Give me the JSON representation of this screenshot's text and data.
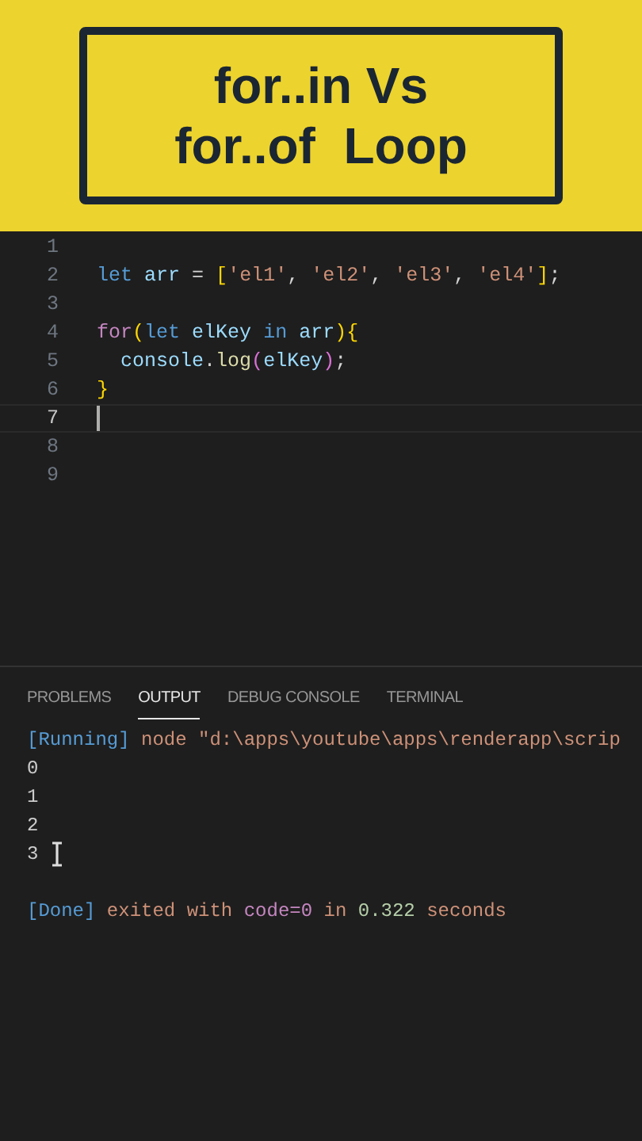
{
  "banner": {
    "title_lines": [
      "for..in Vs",
      "for..of  Loop"
    ]
  },
  "editor": {
    "lines": [
      {
        "number": "1",
        "current": false
      },
      {
        "number": "2",
        "current": false,
        "tokens": [
          {
            "text": "let ",
            "kind": "keyword"
          },
          {
            "text": "arr",
            "kind": "variable"
          },
          {
            "text": " = ",
            "kind": "punct"
          },
          {
            "text": "[",
            "kind": "bracket"
          },
          {
            "text": "'el1'",
            "kind": "string"
          },
          {
            "text": ", ",
            "kind": "punct"
          },
          {
            "text": "'el2'",
            "kind": "string"
          },
          {
            "text": ", ",
            "kind": "punct"
          },
          {
            "text": "'el3'",
            "kind": "string"
          },
          {
            "text": ", ",
            "kind": "punct"
          },
          {
            "text": "'el4'",
            "kind": "string"
          },
          {
            "text": "]",
            "kind": "bracket"
          },
          {
            "text": ";",
            "kind": "punct"
          }
        ]
      },
      {
        "number": "3",
        "current": false
      },
      {
        "number": "4",
        "current": false,
        "tokens": [
          {
            "text": "for",
            "kind": "control"
          },
          {
            "text": "(",
            "kind": "bracket"
          },
          {
            "text": "let ",
            "kind": "keyword"
          },
          {
            "text": "elKey",
            "kind": "variable"
          },
          {
            "text": " in ",
            "kind": "keyword"
          },
          {
            "text": "arr",
            "kind": "variable"
          },
          {
            "text": "){",
            "kind": "bracket"
          }
        ]
      },
      {
        "number": "5",
        "current": false,
        "tokens": [
          {
            "text": "  console",
            "kind": "variable"
          },
          {
            "text": ".",
            "kind": "punct"
          },
          {
            "text": "log",
            "kind": "func"
          },
          {
            "text": "(",
            "kind": "bracket2"
          },
          {
            "text": "elKey",
            "kind": "variable"
          },
          {
            "text": ")",
            "kind": "bracket2"
          },
          {
            "text": ";",
            "kind": "punct"
          }
        ]
      },
      {
        "number": "6",
        "current": false,
        "tokens": [
          {
            "text": "}",
            "kind": "bracket"
          }
        ]
      },
      {
        "number": "7",
        "current": true
      },
      {
        "number": "8",
        "current": false
      },
      {
        "number": "9",
        "current": false
      }
    ]
  },
  "panel": {
    "tabs": [
      {
        "label": "PROBLEMS",
        "selected": false
      },
      {
        "label": "OUTPUT",
        "selected": true
      },
      {
        "label": "DEBUG CONSOLE",
        "selected": false
      },
      {
        "label": "TERMINAL",
        "selected": false
      }
    ],
    "output": [
      {
        "tokens": [
          {
            "text": "[Running]",
            "kind": "info"
          },
          {
            "text": " node \"d:\\apps\\youtube\\apps\\renderapp\\scrip",
            "kind": "string"
          }
        ]
      },
      {
        "tokens": [
          {
            "text": "0",
            "kind": "plain"
          }
        ]
      },
      {
        "tokens": [
          {
            "text": "1",
            "kind": "plain"
          }
        ]
      },
      {
        "tokens": [
          {
            "text": "2",
            "kind": "plain"
          }
        ]
      },
      {
        "tokens": [
          {
            "text": "3",
            "kind": "plain"
          }
        ],
        "pointer": true
      },
      {
        "tokens": [
          {
            "text": "[Done]",
            "kind": "info"
          },
          {
            "text": " exited with ",
            "kind": "string"
          },
          {
            "text": "code=0",
            "kind": "control"
          },
          {
            "text": " in ",
            "kind": "string"
          },
          {
            "text": "0.322",
            "kind": "number"
          },
          {
            "text": " seconds",
            "kind": "string"
          }
        ]
      }
    ]
  }
}
